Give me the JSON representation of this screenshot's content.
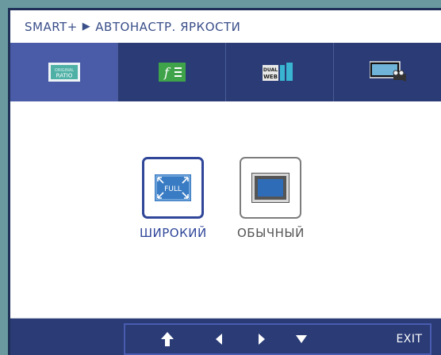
{
  "header": {
    "breadcrumb_root": "SMART+",
    "breadcrumb_page": "АВТОНАСТР. ЯРКОСТИ"
  },
  "tabs": [
    {
      "icon": "original-ratio-icon",
      "text_top": "ORIGINAL",
      "text_bottom": "RATIO",
      "active": true
    },
    {
      "icon": "f-engine-icon",
      "text": "f",
      "active": false
    },
    {
      "icon": "dual-web-icon",
      "text_top": "DUAL",
      "text_bottom": "WEB",
      "active": false
    },
    {
      "icon": "cinema-mode-icon",
      "active": false
    }
  ],
  "options": [
    {
      "label": "ШИРОКИЙ",
      "badge": "FULL",
      "selected": true
    },
    {
      "label": "ОБЫЧНЫЙ",
      "selected": false
    }
  ],
  "footer": {
    "exit_label": "EXIT"
  },
  "colors": {
    "accent": "#2f4699",
    "bar": "#2a3b76",
    "active_tab": "#4a5ca8"
  }
}
